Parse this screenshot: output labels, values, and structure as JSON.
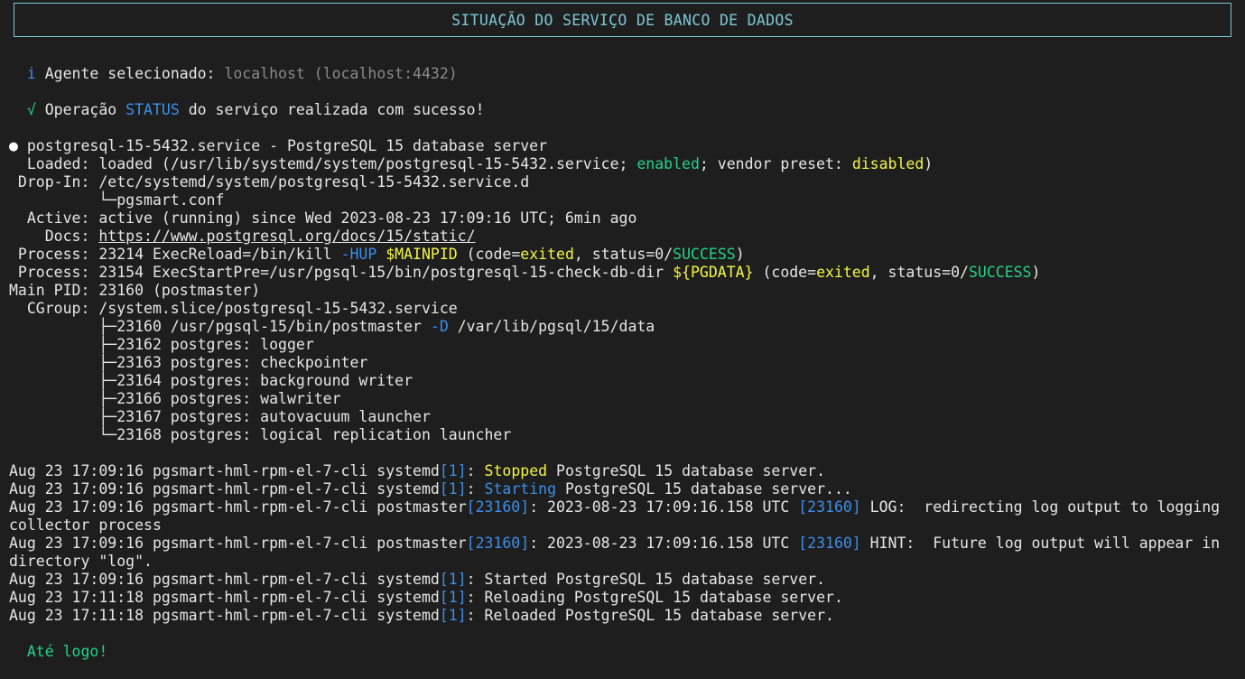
{
  "header": {
    "title": "SITUAÇÃO DO SERVIÇO DE BANCO DE DADOS"
  },
  "agent": {
    "icon": "i",
    "label": "Agente selecionado:",
    "value": "localhost (localhost:4432)"
  },
  "operation": {
    "icon": "√",
    "prefix": "Operação",
    "keyword": "STATUS",
    "suffix": "do serviço realizada com sucesso!"
  },
  "status": {
    "bullet": "●",
    "unit": " postgresql-15-5432.service - PostgreSQL 15 database server",
    "loaded_label": "  Loaded: ",
    "loaded_pre": "loaded (/usr/lib/systemd/system/postgresql-15-5432.service; ",
    "loaded_enabled": "enabled",
    "loaded_mid": "; vendor preset: ",
    "loaded_disabled": "disabled",
    "loaded_end": ")",
    "dropin_label": " Drop-In: ",
    "dropin_path": "/etc/systemd/system/postgresql-15-5432.service.d",
    "dropin_file": "          └─pgsmart.conf",
    "active_label": "  Active: ",
    "active_value": "active (running) since Wed 2023-08-23 17:09:16 UTC; 6min ago",
    "docs_label": "    Docs: ",
    "docs_url": "https://www.postgresql.org/docs/15/static/",
    "process1_pre": " Process: 23214 ExecReload=/bin/kill ",
    "process1_flag": "-HUP",
    "process1_sp": " ",
    "process1_var": "$MAINPID",
    "process1_code": " (code=",
    "process1_exited": "exited",
    "process1_status": ", status=0/",
    "process1_success": "SUCCESS",
    "process1_end": ")",
    "process2_pre": " Process: 23154 ExecStartPre=/usr/pgsql-15/bin/postgresql-15-check-db-dir ",
    "process2_var": "${PGDATA}",
    "process2_code": " (code=",
    "process2_exited": "exited",
    "process2_status": ", status=0/",
    "process2_success": "SUCCESS",
    "process2_end": ")",
    "mainpid": "Main PID: 23160 (postmaster)",
    "cgroup": "  CGroup: /system.slice/postgresql-15-5432.service",
    "tree0_pre": "          ├─23160 /usr/pgsql-15/bin/postmaster ",
    "tree0_flag": "-D",
    "tree0_post": " /var/lib/pgsql/15/data",
    "tree": [
      "          ├─23162 postgres: logger",
      "          ├─23163 postgres: checkpointer",
      "          ├─23164 postgres: background writer",
      "          ├─23166 postgres: walwriter",
      "          ├─23167 postgres: autovacuum launcher",
      "          └─23168 postgres: logical replication launcher"
    ]
  },
  "logs": {
    "host": "Aug 23 17:09:16 pgsmart-hml-rpm-el-7-cli ",
    "host2": "Aug 23 17:11:18 pgsmart-hml-rpm-el-7-cli ",
    "systemd": "systemd",
    "pid1": "[1]",
    "postmaster": "postmaster",
    "pid23160": "[23160]",
    "colon": ": ",
    "stopped": "Stopped",
    "stopped_rest": " PostgreSQL 15 database server.",
    "starting": "Starting",
    "starting_rest": " PostgreSQL 15 database server...",
    "log_ts": ": 2023-08-23 17:09:16.158 UTC ",
    "log_msg": " LOG:  redirecting log output to logging",
    "log_cont": "collector process",
    "hint_msg": " HINT:  Future log output will appear in",
    "hint_cont": "directory \"log\".",
    "started": "Started PostgreSQL 15 database server.",
    "reloading": "Reloading PostgreSQL 15 database server.",
    "reloaded": "Reloaded PostgreSQL 15 database server."
  },
  "footer": {
    "goodbye": "Até logo!"
  },
  "colors": {
    "background": "#1e1e1e",
    "text": "#e6e6e6",
    "cyan": "#7cc8d4",
    "blue": "#3b8eea",
    "green": "#23d18b",
    "yellow": "#f5f543",
    "gray": "#8a8a8a"
  }
}
